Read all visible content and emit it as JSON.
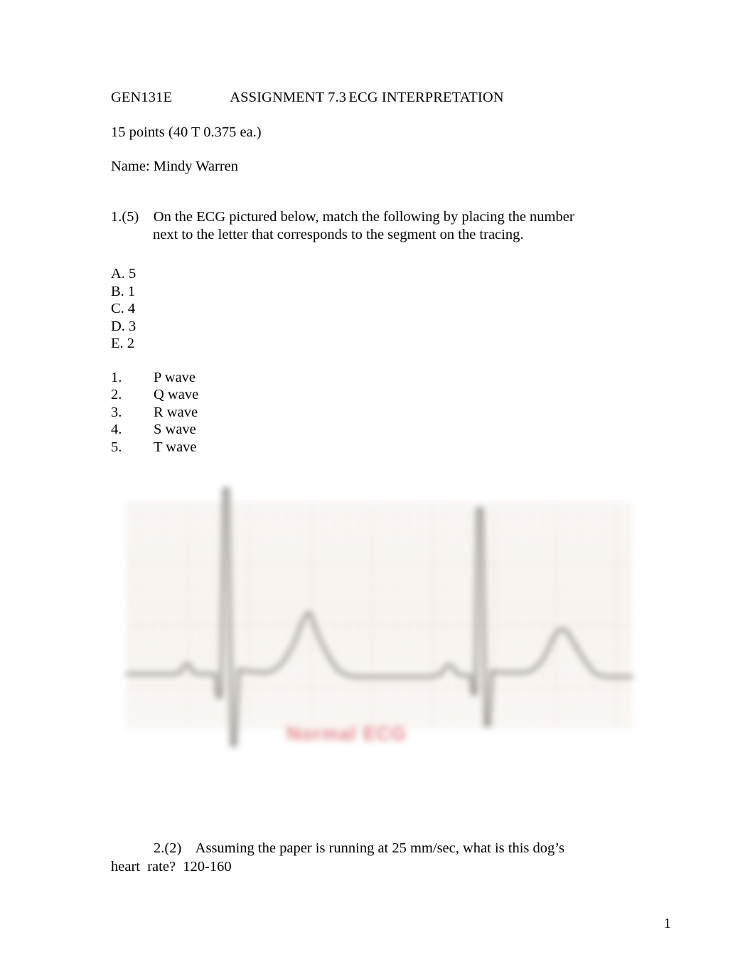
{
  "document": {
    "header": {
      "course_code": "GEN131E",
      "assignment": "ASSIGNMENT 7.3",
      "topic": "ECG INTERPRETATION",
      "header_line": "GEN131E\t\tASSIGNMENT 7.3\tECG INTERPRETATION",
      "points_line": "15 points (40 T 0.375 ea.)",
      "name_line": "Name: Mindy Warren"
    },
    "question1": {
      "number_points": "1.(5)",
      "prompt_line1": "On the ECG pictured below, match the following by placing the number",
      "prompt_line2": "next to the letter that corresponds to the segment on the tracing.",
      "letter_answers": [
        {
          "letter": "A.",
          "answer": "5",
          "text": "A. 5"
        },
        {
          "letter": "B.",
          "answer": "1",
          "text": "B. 1"
        },
        {
          "letter": "C.",
          "answer": "4",
          "text": "C. 4"
        },
        {
          "letter": "D.",
          "answer": "3",
          "text": "D. 3"
        },
        {
          "letter": "E.",
          "answer": "2",
          "text": "E. 2"
        }
      ],
      "wave_options": [
        {
          "num": "1.",
          "label": "P wave"
        },
        {
          "num": "2.",
          "label": "Q wave"
        },
        {
          "num": "3.",
          "label": "R wave"
        },
        {
          "num": "4.",
          "label": "S wave"
        },
        {
          "num": "5.",
          "label": "T wave"
        }
      ]
    },
    "figure": {
      "caption": "Normal ECG",
      "caption_color": "#d9676a",
      "paper_color": "#f7f3ef",
      "grid_color": "#d6a8a0",
      "trace_color": "#8e8a86"
    },
    "question2": {
      "number_points": "2.(2)",
      "prompt_line1": "Assuming the paper is running at 25 mm/sec, what is this dog’s",
      "prompt_line2_label": "heart  rate?",
      "answer": "120-160",
      "prompt_line2": "heart  rate?  120-160"
    },
    "footer": {
      "page_number": "1"
    }
  }
}
